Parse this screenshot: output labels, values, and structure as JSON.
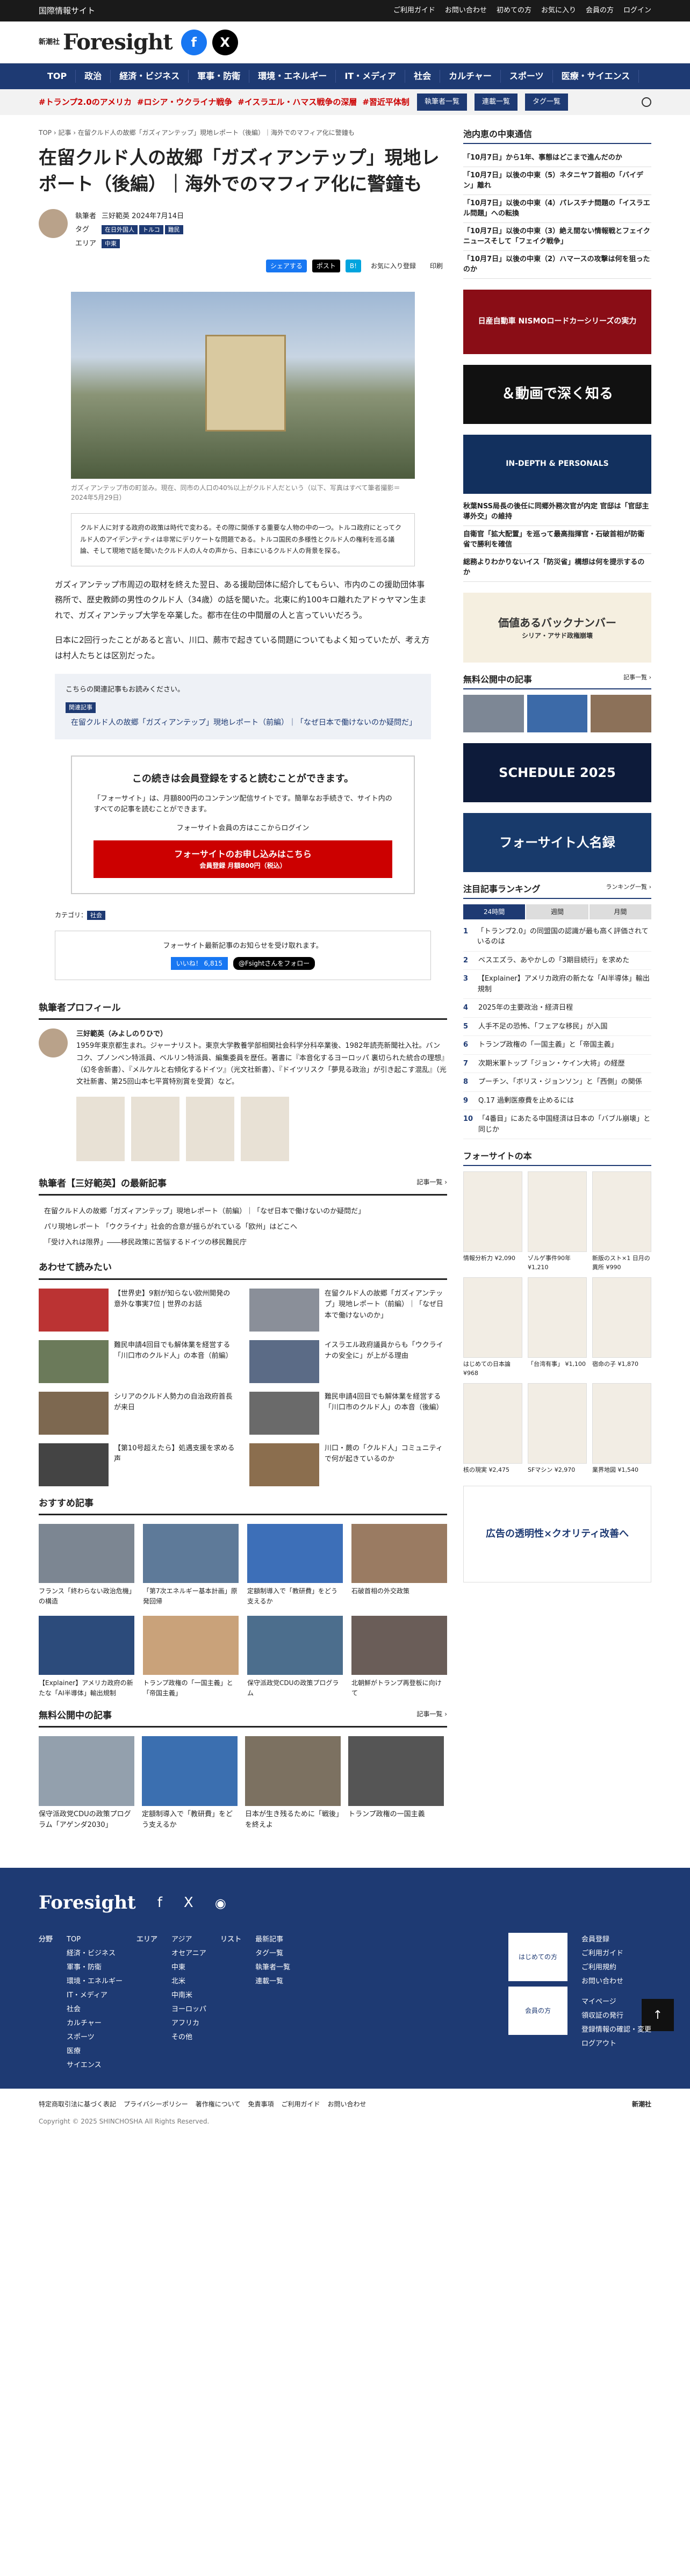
{
  "topbar": {
    "label": "国際情報サイト",
    "guide": "ご利用ガイド",
    "contact": "お問い合わせ",
    "first": "初めての方",
    "favorites": "お気に入り",
    "members": "会員の方",
    "login": "ログイン"
  },
  "header": {
    "logo_sub": "新潮社",
    "logo": "Foresight"
  },
  "nav": [
    "TOP",
    "政治",
    "経済・ビジネス",
    "軍事・防衛",
    "環境・エネルギー",
    "IT・メディア",
    "社会",
    "カルチャー",
    "スポーツ",
    "医療・サイエンス"
  ],
  "trends": [
    "#トランプ2.0のアメリカ",
    "#ロシア・ウクライナ戦争",
    "#イスラエル・ハマス戦争の深層",
    "#習近平体制"
  ],
  "trend_buttons": [
    "執筆者一覧",
    "連載一覧",
    "タグ一覧"
  ],
  "breadcrumb": "TOP › 記事 › 在留クルド人の故郷「ガズィアンテップ」現地レポート（後編）｜海外でのマフィア化に警鐘も",
  "article": {
    "title": "在留クルド人の故郷「ガズィアンテップ」現地レポート（後編）｜海外でのマフィア化に警鐘も",
    "author_label": "執筆者",
    "author": "三好範英",
    "date": "2024年7月14日",
    "tag_label": "タグ",
    "tags": [
      "在日外国人",
      "トルコ",
      "難民"
    ],
    "area_label": "エリア",
    "area": "中東",
    "share": [
      "シェアする",
      "ポスト",
      "B!",
      "お気に入り登録",
      "印刷"
    ],
    "caption": "ガズィアンテップ市の町並み。現在、同市の人口の40%以上がクルド人だという（以下、写真はすべて筆者撮影＝2024年5月29日）",
    "summary": "クルド人に対する政府の政策は時代で変わる。その際に関係する重要な人物の中の一つ。トルコ政府にとってクルド人のアイデンティティは非常にデリケートな問題である。トルコ国民の多様性とクルド人の権利を巡る議論、そして現地で話を聞いたクルド人の人々の声から、日本にいるクルド人の背景を探る。",
    "p1": "ガズィアンテップ市周辺の取材を終えた翌日、ある援助団体に紹介してもらい、市内のこの援助団体事務所で、歴史教師の男性のクルド人（34歳）の話を聞いた。北東に約100キロ離れたアドゥヤマン生まれで、ガズィアンテップ大学を卒業した。都市在住の中間層の人と言っていいだろう。",
    "p2": "日本に2回行ったことがあると言い、川口、蕨市で起きている問題についてもよく知っていたが、考え方は村人たちとは区別だった。"
  },
  "related": {
    "heading": "こちらの関連記事もお読みください。",
    "badge": "関連記事",
    "link": "在留クルド人の故郷「ガズィアンテップ」現地レポート（前編）｜「なぜ日本で働けないのか疑問だ」"
  },
  "paywall": {
    "title": "この続きは会員登録をすると読むことができます。",
    "desc": "「フォーサイト」は、月額800円のコンテンツ配信サイトです。簡単なお手続きで、サイト内のすべての記事を読むことができます。",
    "login": "フォーサイト会員の方はここからログイン",
    "cta": "フォーサイトのお申し込みはこちら",
    "cta_sub": "会員登録 月額800円（税込）"
  },
  "category": {
    "label": "カテゴリ：",
    "value": "社会"
  },
  "notice": {
    "text": "フォーサイト最新記事のお知らせを受け取れます。",
    "like": "いいね！ 6,815",
    "follow": "@Fsightさんをフォロー"
  },
  "profile": {
    "heading": "執筆者プロフィール",
    "name": "三好範英（みよしのりひで）",
    "bio": "1959年東京都生まれ。ジャーナリスト。東京大学教養学部相関社会科学分科卒業後、1982年読売新聞社入社。バンコク、プノンペン特派員、ベルリン特派員、編集委員を歴任。著書に『本音化するヨーロッパ 裏切られた統合の理想』（幻冬舎新書）、『メルケルと右傾化するドイツ』（光文社新書）、『ドイツリスク「夢見る政治」が引き起こす混乱』（光文社新書、第25回山本七平賞特別賞を受賞）など。"
  },
  "latest": {
    "heading": "執筆者【三好範英】の最新記事",
    "more": "記事一覧 ›",
    "items": [
      "在留クルド人の故郷「ガズィアンテップ」現地レポート（前編）｜「なぜ日本で働けないのか疑問だ」",
      "パリ現地レポート 「ウクライナ」社会的合意が揺らがれている「欧州」はどこへ",
      "「受け入れは限界」――移民政策に苦悩するドイツの移民難民庁"
    ]
  },
  "alsoread": {
    "heading": "あわせて読みたい",
    "items": [
      "【世界史】9割が知らない欧州開発の意外な事実7位 | 世界のお話",
      "在留クルド人の故郷「ガズィアンテップ」現地レポート（前編）｜「なぜ日本で働けないのか」",
      "難民申請4回目でも解体業を経営する「川口市のクルド人」の本音（前編）",
      "イスラエル政府議員からも「ウクライナの安全に」が上がる理由",
      "シリアのクルド人勢力の自治政府首長が来日",
      "難民申請4回目でも解体業を経営する「川口市のクルド人」の本音（後編）",
      "【第10号超えたら】処遇支援を求める声",
      "川口・蕨の「クルド人」コミュニティで何が起きているのか"
    ]
  },
  "recommend": {
    "heading": "おすすめ記事",
    "items": [
      "フランス「終わらない政治危機」の構造",
      "「第7次エネルギー基本計画」原発回帰",
      "定額制導入で「教研費」をどう支えるか",
      "石破首相の外交政策",
      "【Explainer】アメリカ政府の新たな「AI半導体」輸出規制",
      "トランプ政権の「一国主義」と「帝国主義」",
      "保守派政党CDUの政策プログラム",
      "北朝鮮がトランプ再登板に向けて"
    ]
  },
  "freecarousel": {
    "heading": "無料公開中の記事",
    "more": "記事一覧 ›",
    "items": [
      "保守派政党CDUの政策プログラム「アゲンダ2030」",
      "定額制導入で「教研費」をどう支えるか",
      "日本が生き残るために「戦後」を終えよ",
      "トランプ政権の一国主義"
    ]
  },
  "side": {
    "series_head": "池内恵の中東通信",
    "series": [
      "「10月7日」から1年、事態はどこまで進んだのか",
      "「10月7日」以後の中東（5）ネタニヤフ首相の「バイデン」離れ",
      "「10月7日」以後の中東（4）パレスチナ問題の「イスラエル問題」への転換",
      "「10月7日」以後の中東（3）絶え間ない情報戦とフェイクニュースそして「フェイク戦争」",
      "「10月7日」以後の中東（2）ハマースの攻撃は何を狙ったのか"
    ],
    "ad1": "日産自動車 NISMOロードカーシリーズの実力",
    "ad2": "＆動画で深く知る",
    "indepth_head": "IN-DEPTH & PERSONALS",
    "indepth": [
      "秋葉NSS局長の後任に同郷外務次官が内定 官邸は「官邸主導外交」の維持",
      "自衛官「拡大配置」を巡って最高指揮官・石破首相が防衛省で勝利を確信",
      "総務よりわかりないイス「防災省」構想は何を提示するのか"
    ],
    "backnumber": "価値あるバックナンバー",
    "bn_item": "シリア・アサド政権崩壊",
    "free_head": "無料公開中の記事",
    "free_more": "記事一覧 ›",
    "schedule": "SCHEDULE 2025",
    "meikan": "フォーサイト人名録",
    "rank_head": "注目記事ランキング",
    "rank_more": "ランキング一覧 ›",
    "rank_tabs": [
      "24時間",
      "週間",
      "月間"
    ],
    "rank": [
      "「トランプ2.0」の同盟国の認識が最も高く評価されているのは",
      "ベスエズラ、あやかしの「3期目続行」を求めた",
      "【Explainer】アメリカ政府の新たな「AI半導体」輸出規制",
      "2025年の主要政治・経済日程",
      "人手不足の恐怖、「フェアな移民」が入国",
      "トランプ政権の「一国主義」と「帝国主義」",
      "次期米軍トップ「ジョン・ケイン大将」の経歴",
      "プーチン、「ボリス・ジョンソン」と「西側」の関係",
      "Q.17 過剰医療費を止めるには",
      "「4番目」にあたる中国経済は日本の「バブル崩壊」と同じか"
    ],
    "books_head": "フォーサイトの本",
    "books": [
      "情報分析力 ¥2,090",
      "ゾルゲ事件90年 ¥1,210",
      "新版のスト×1 日月の異所 ¥990",
      "はじめての日本論 ¥968",
      "「台湾有事」 ¥1,100",
      "宿命の子 ¥1,870",
      "核の現実 ¥2,475",
      "SFマシン ¥2,970",
      "業界地図 ¥1,540"
    ],
    "ad3": "広告の透明性×クオリティ改善へ"
  },
  "footer": {
    "logo": "Foresight",
    "col1_head": "分野",
    "col1": [
      "TOP",
      "経済・ビジネス",
      "軍事・防衛",
      "環境・エネルギー",
      "IT・メディア",
      "社会",
      "カルチャー",
      "スポーツ",
      "医療",
      "サイエンス"
    ],
    "col2_head": "エリア",
    "col2": [
      "アジア",
      "オセアニア",
      "中東",
      "北米",
      "中南米",
      "ヨーロッパ",
      "アフリカ",
      "その他"
    ],
    "col3_head": "リスト",
    "col3": [
      "最新記事",
      "タグ一覧",
      "執筆者一覧",
      "連載一覧"
    ],
    "btn1": "はじめての方",
    "btn2": "会員の方",
    "links1": [
      "会員登録",
      "ご利用ガイド",
      "ご利用規約",
      "お問い合わせ"
    ],
    "links2": [
      "マイページ",
      "領収証の発行",
      "登録情報の確認・変更",
      "ログアウト"
    ]
  },
  "bottom": {
    "links": [
      "特定商取引法に基づく表記",
      "プライバシーポリシー",
      "著作権について",
      "免責事項",
      "ご利用ガイド",
      "お問い合わせ"
    ],
    "copy": "Copyright © 2025 SHINCHOSHA All Rights Reserved.",
    "brand": "新潮社"
  }
}
